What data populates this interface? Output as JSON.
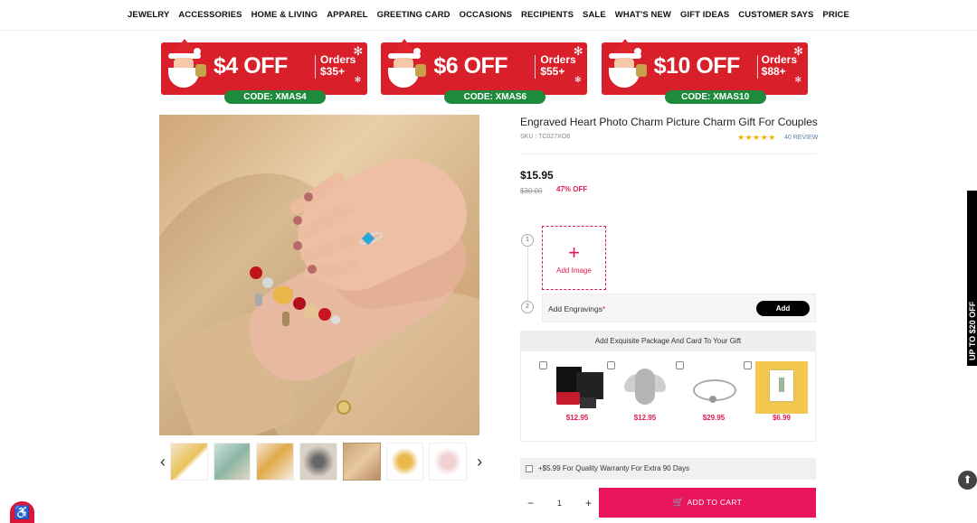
{
  "nav": [
    "JEWELRY",
    "ACCESSORIES",
    "HOME & LIVING",
    "APPAREL",
    "GREETING CARD",
    "OCCASIONS",
    "RECIPIENTS",
    "SALE",
    "WHAT'S NEW",
    "GIFT IDEAS",
    "CUSTOMER SAYS",
    "PRICE"
  ],
  "banners": [
    {
      "amount": "$4 OFF",
      "orders_top": "Orders",
      "orders_bottom": "$35+",
      "code": "CODE: XMAS4"
    },
    {
      "amount": "$6 OFF",
      "orders_top": "Orders",
      "orders_bottom": "$55+",
      "code": "CODE: XMAS6"
    },
    {
      "amount": "$10 OFF",
      "orders_top": "Orders",
      "orders_bottom": "$88+",
      "code": "CODE: XMAS10"
    }
  ],
  "product": {
    "title": "Engraved Heart Photo Charm Picture Charm Gift For Couples",
    "sku": "SKU : TC027XO8",
    "stars": "★★★★★",
    "rating": 5,
    "reviews": "40 REVIEW",
    "price": "$15.95",
    "old_price": "$30.00",
    "discount": "47% OFF"
  },
  "customize": {
    "step1": "1",
    "step2": "2",
    "add_image_icon": "+",
    "add_image": "Add Image",
    "engravings_label": "Add Engravings",
    "required_mark": "*",
    "add_button": "Add"
  },
  "package": {
    "heading": "Add Exquisite Package And Card To Your Gift",
    "items": [
      {
        "name": "gift-box",
        "price": "$12.95"
      },
      {
        "name": "angel-wing-charm",
        "price": "$12.95"
      },
      {
        "name": "bracelet-chain",
        "price": "$29.95"
      },
      {
        "name": "greeting-card",
        "price": "$6.99"
      }
    ]
  },
  "warranty": "+$5.99 For Quality Warranty For Extra 90 Days",
  "quantity": {
    "minus": "−",
    "value": "1",
    "plus": "+"
  },
  "cart": {
    "icon": "🛒",
    "label": "ADD TO CART"
  },
  "side_tab": "UP TO $20 OFF",
  "thumbs": {
    "prev": "‹",
    "next": "›",
    "count": 7,
    "active_index": 4
  },
  "colors": {
    "accent": "#e8155a",
    "banner_red": "#d81f2a",
    "code_green": "#1e8b3c",
    "star": "#f6b400"
  }
}
